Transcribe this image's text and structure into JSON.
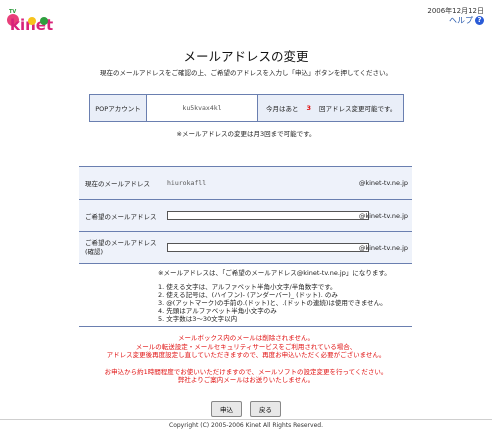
{
  "header": {
    "date": "2006年12月12日",
    "help_label": "ヘルプ",
    "help_icon": "?"
  },
  "logo": {
    "small_text": "TV",
    "wordmark": "kinet"
  },
  "page": {
    "title": "メールアドレスの変更",
    "lead": "現在のメールアドレスをご確認の上、ご希望のアドレスを入力し「申込」ボタンを押してください。"
  },
  "account_info": {
    "pop_label": "POPアカウント",
    "pop_value": "ku5kvax4kl",
    "remaining_prefix": "今月はあと",
    "remaining_count": "3",
    "remaining_suffix": "回アドレス変更可能です。"
  },
  "note1": "※メールアドレスの変更は月3回まで可能です。",
  "form": {
    "current_label": "現在のメールアドレス",
    "current_value": "hiurokafll",
    "domain": "@kinet-tv.ne.jp",
    "desired_label": "ご希望のメールアドレス",
    "desired_value": "",
    "confirm_label_1": "ご希望のメールアドレス",
    "confirm_label_2": "(確認)",
    "confirm_value": ""
  },
  "note2": "※メールアドレスは、「ご希望のメールアドレス@kinet-tv.ne.jp」になります。",
  "rules": [
    "1. 使える文字は、アルファベット半角小文字/半角数字です。",
    "2. 使える記号は、(ハイフン)- (アンダーバー)_ (ドット). のみ",
    "3. @(アットマーク)の手前の.(ドット)と、.(ドットの連続)は使用できません。",
    "4. 先頭はアルファベット半角小文字のみ",
    "5. 文字数は3〜30文字以内"
  ],
  "warnings": [
    "メールボックス内のメールは削除されません。",
    "メールの転送設定・メールセキュリティサービスをご利用されている場合、",
    "アドレス変更後再度設定し直していただきますので、再度お申込いただく必要がございません。",
    "",
    "お申込から約1時間程度でお使いいただけますので、メールソフトの設定変更を行ってください。",
    "弊社よりご案内メールはお送りいたしません。"
  ],
  "buttons": {
    "submit": "申込",
    "back": "戻る"
  },
  "footer": "Copyright (C) 2005-2006 Kinet All Rights Reserved.",
  "colors": {
    "accent_blue": "#6a7fb0",
    "warn_red": "#e01010",
    "row_bg": "#eef2fa"
  }
}
